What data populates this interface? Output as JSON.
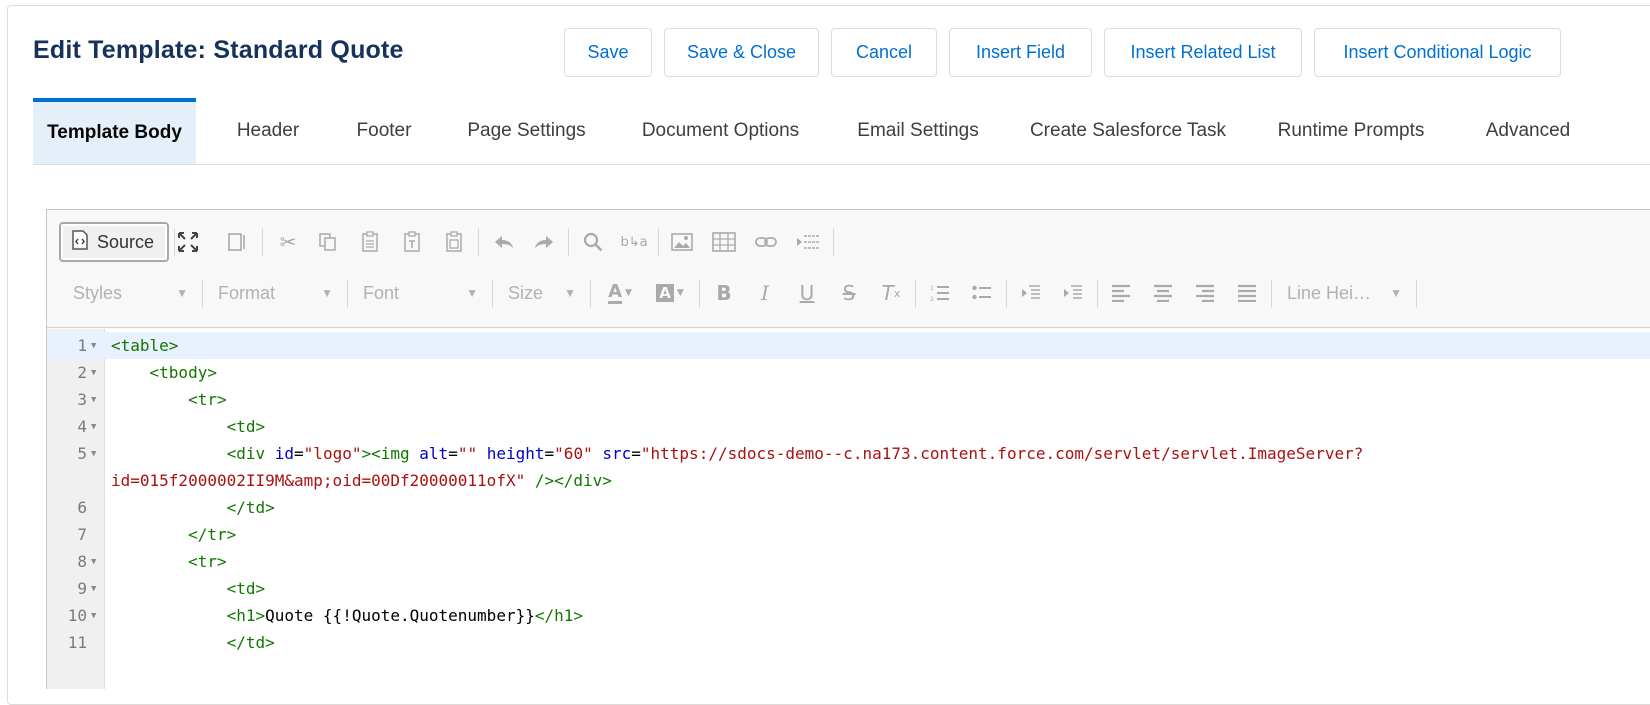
{
  "header": {
    "title": "Edit Template: Standard Quote",
    "buttons": {
      "save": "Save",
      "save_close": "Save & Close",
      "cancel": "Cancel",
      "insert_field": "Insert Field",
      "insert_related_list": "Insert Related List",
      "insert_conditional_logic": "Insert Conditional Logic"
    }
  },
  "tabs": {
    "template_body": "Template Body",
    "header": "Header",
    "footer": "Footer",
    "page_settings": "Page Settings",
    "document_options": "Document Options",
    "email_settings": "Email Settings",
    "create_salesforce_task": "Create Salesforce Task",
    "runtime_prompts": "Runtime Prompts",
    "advanced": "Advanced",
    "active": "Template Body"
  },
  "toolbar": {
    "source_label": "Source",
    "styles": "Styles",
    "format": "Format",
    "font": "Font",
    "size": "Size",
    "line_height": "Line Hei…"
  },
  "code": {
    "line_numbers": [
      "1",
      "2",
      "3",
      "4",
      "5",
      "6",
      "7",
      "8",
      "9",
      "10",
      "11"
    ],
    "lines": {
      "l1": "<table>",
      "l2": "<tbody>",
      "l3": "<tr>",
      "l4": "<td>",
      "l5a_tag1": "<div",
      "l5a_attr1": "id",
      "l5a_val1": "\"logo\"",
      "l5a_tag2": "><img",
      "l5a_attr2": "alt",
      "l5a_val2": "\"\"",
      "l5a_attr3": "height",
      "l5a_val3": "\"60\"",
      "l5a_attr4": "src",
      "l5a_val4": "\"https://sdocs-demo--c.na173.content.force.com/servlet/servlet.ImageServer?",
      "l5b_val": "id=015f2000002II9M&amp;oid=00Df20000011ofX\"",
      "l5b_tag": "/></div>",
      "l6": "</td>",
      "l7": "</tr>",
      "l8": "<tr>",
      "l9": "<td>",
      "l10_open": "<h1>",
      "l10_text": "Quote {{!Quote.Quotenumber}}",
      "l10_close": "</h1>",
      "l11": "</td>"
    }
  },
  "colors": {
    "accent": "#0070d2",
    "title": "#16325c",
    "tag": "#117700",
    "attr": "#0000cc",
    "string": "#aa1111"
  }
}
